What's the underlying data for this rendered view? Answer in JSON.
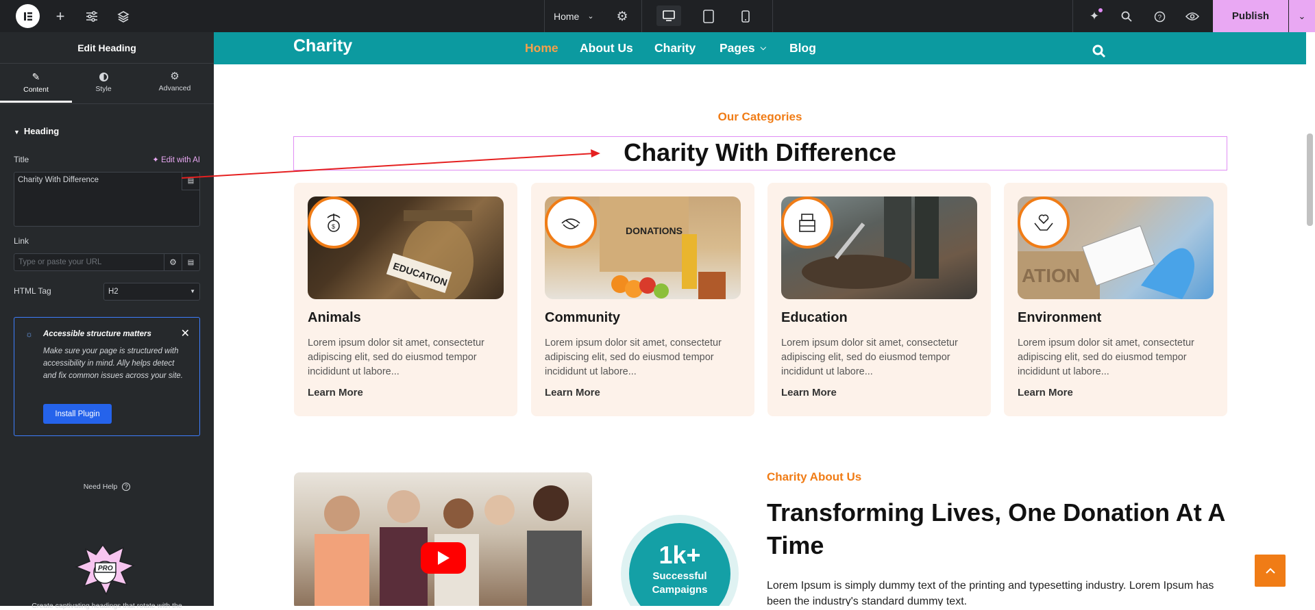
{
  "topbar": {
    "page_select": "Home",
    "publish": "Publish"
  },
  "panel": {
    "title": "Edit Heading",
    "tabs": [
      "Content",
      "Style",
      "Advanced"
    ],
    "section": "Heading",
    "title_label": "Title",
    "edit_ai": "Edit with AI",
    "title_value": "Charity With Difference",
    "link_label": "Link",
    "link_placeholder": "Type or paste your URL",
    "html_tag_label": "HTML Tag",
    "html_tag_value": "H2",
    "notice_title": "Accessible structure matters",
    "notice_text": "Make sure your page is structured with accessibility in mind. Ally helps detect and fix common issues across your site.",
    "install": "Install Plugin",
    "need_help": "Need Help",
    "promo_text": "Create captivating headings that rotate with the"
  },
  "site": {
    "logo": "Charity",
    "nav": [
      "Home",
      "About Us",
      "Charity",
      "Pages",
      "Blog"
    ],
    "categories_sub": "Our Categories",
    "categories_title": "Charity With Difference",
    "cards": [
      {
        "title": "Animals",
        "text": "Lorem ipsum dolor sit amet, consectetur adipiscing elit, sed do eiusmod tempor incididunt ut labore...",
        "more": "Learn More"
      },
      {
        "title": "Community",
        "text": "Lorem ipsum dolor sit amet, consectetur adipiscing elit, sed do eiusmod tempor incididunt ut labore...",
        "more": "Learn More"
      },
      {
        "title": "Education",
        "text": "Lorem ipsum dolor sit amet, consectetur adipiscing elit, sed do eiusmod tempor incididunt ut labore...",
        "more": "Learn More"
      },
      {
        "title": "Environment",
        "text": "Lorem ipsum dolor sit amet, consectetur adipiscing elit, sed do eiusmod tempor incididunt ut labore...",
        "more": "Learn More"
      }
    ],
    "about_sub": "Charity About Us",
    "about_title": "Transforming Lives, One Donation At A Time",
    "about_text": "Lorem Ipsum is simply dummy text of the printing and typesetting industry. Lorem Ipsum has been the industry's standard dummy text.",
    "stat_number": "1k+",
    "stat_label": "Successful Campaigns",
    "image_word_1": "EDUCATION",
    "image_word_2": "DONATIONS",
    "image_word_3": "ATION"
  },
  "colors": {
    "accent": "#f07c16",
    "teal": "#0c9aa0",
    "publish": "#e9a8f3"
  }
}
